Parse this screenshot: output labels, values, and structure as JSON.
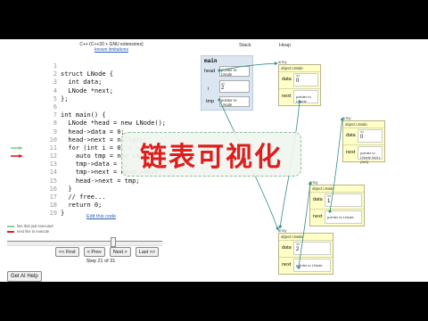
{
  "header": {
    "lang_label": "C++ (C++20 + GNU extensions)",
    "known_limitations": "known limitations"
  },
  "code": {
    "lines": [
      {
        "n": "1",
        "t": ""
      },
      {
        "n": "2",
        "t": "struct LNode {"
      },
      {
        "n": "3",
        "t": "  int data;"
      },
      {
        "n": "4",
        "t": "  LNode *next;"
      },
      {
        "n": "5",
        "t": "};"
      },
      {
        "n": "6",
        "t": ""
      },
      {
        "n": "7",
        "t": "int main() {"
      },
      {
        "n": "8",
        "t": "  LNode *head = new LNode();"
      },
      {
        "n": "9",
        "t": "  head->data = 0;"
      },
      {
        "n": "10",
        "t": "  head->next = nullptr;"
      },
      {
        "n": "11",
        "t": "  for (int i = 0; i < 3"
      },
      {
        "n": "12",
        "t": "    auto tmp = new LNode"
      },
      {
        "n": "13",
        "t": "    tmp->data = i;"
      },
      {
        "n": "14",
        "t": "    tmp->next = head->next;"
      },
      {
        "n": "15",
        "t": "    head->next = tmp;"
      },
      {
        "n": "16",
        "t": "  }"
      },
      {
        "n": "17",
        "t": "  // free..."
      },
      {
        "n": "18",
        "t": "  return 0;"
      },
      {
        "n": "19",
        "t": "}"
      }
    ],
    "prev_line_index": 10,
    "next_line_index": 11,
    "edit_link": "Edit this code"
  },
  "legend": {
    "just_executed": "line that just executed",
    "next_line": "next line to execute",
    "just_executed_color": "#8ccf8c",
    "next_line_color": "#e02020"
  },
  "controls": {
    "first": "<< First",
    "prev": "< Prev",
    "next": "Next >",
    "last": "Last >>",
    "step_text": "Step 21 of 31",
    "ai_help": "Get AI Help",
    "step_fraction": 0.677
  },
  "viz": {
    "stack_header": "Stack",
    "heap_header": "Heap",
    "frame_name": "main",
    "vars": [
      {
        "name": "head",
        "value": "pointer to LNode"
      },
      {
        "name": "i",
        "type": "int",
        "value": "2"
      },
      {
        "name": "tmp",
        "value": "pointer to LNode"
      }
    ],
    "heap_objects": [
      {
        "label": "array",
        "type": "object LNode",
        "data_type": "int",
        "data": "0",
        "next": "pointer to LNode"
      },
      {
        "label": "array",
        "type": "object LNode",
        "data_type": "int",
        "data": "0",
        "next": "pointer to LNode NULL (0x0)"
      },
      {
        "label": "array",
        "type": "object LNode",
        "data_type": "int",
        "data": "1",
        "next": "pointer to LNode"
      },
      {
        "label": "array",
        "type": "object LNode",
        "data_type": "int",
        "data": "2",
        "next": "pointer to LNode"
      }
    ],
    "arrow_color": "#2c8f86"
  },
  "overlay": {
    "title": "链表可视化",
    "title_color": "#e01c1c"
  }
}
